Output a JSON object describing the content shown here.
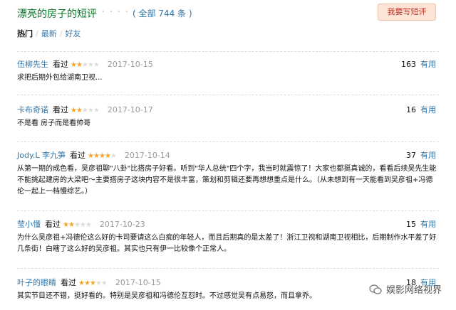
{
  "header": {
    "title": "漂亮的房子的短评",
    "dots": "· · · · · ·",
    "all_count": "( 全部 744 条 )",
    "write_button": "我要写短评"
  },
  "sort": {
    "hot": "热门",
    "latest": "最新",
    "friends": "好友",
    "separator": "/"
  },
  "reviews": [
    {
      "author": "伍柳先生",
      "saw": "看过",
      "rating_stars": 2,
      "date": "2017-10-15",
      "votes": "163",
      "votes_label": "有用",
      "text": "求把后期外包给湖南卫视..."
    },
    {
      "author": "卡布奇诺",
      "saw": "看过",
      "rating_stars": 2,
      "date": "2017-10-17",
      "votes": "16",
      "votes_label": "有用",
      "text": "不是看 房子而是看帅哥"
    },
    {
      "author": "Jody.L 李九笋",
      "saw": "看过",
      "rating_stars": 4,
      "date": "2017-10-14",
      "votes": "37",
      "votes_label": "有用",
      "text": "从第一期的成色看，吴彦祖聊\"八卦\"比搭房子好看。听到\"华人总统\"四个字，我当时就震惊了！大家也都挺真诚的，看看后续吴先生能不能挑起建房的大梁吧～主要搭房子这块内容不是很丰富，策划和剪辑还要再想想重点是什么。（从未想到有一天能看到吴彦祖+冯德伦一起上一档慢综艺。）"
    },
    {
      "author": "莹小懂",
      "saw": "看过",
      "rating_stars": 2,
      "date": "2017-10-23",
      "votes": "15",
      "votes_label": "有用",
      "text": "为什么吴彦祖+冯德伦这么好的卡司要请这么白痴的年轻人，而且后期真的是太差了！浙江卫视和湖南卫视相比，后期制作水平差了好几条街！白瞎了这么好的吴彦祖。其实也只有伊一比较像个正常人。"
    },
    {
      "author": "叶子的眼睛",
      "saw": "看过",
      "rating_stars": 3,
      "date": "2017-10-15",
      "votes": "18",
      "votes_label": "有用",
      "text": "其实节目还不错，挺好看的。特别是吴彦祖和冯德伦互怼时。不过感觉吴有点易怒，而且拿乔。"
    }
  ],
  "watermark": {
    "text": "娱影网络视界",
    "icon": "wechat-icon"
  },
  "colors": {
    "title_green": "#007722",
    "link_blue": "#3377aa",
    "star_orange": "#f5a623",
    "button_bg": "#fde4d6",
    "button_text": "#c0392b"
  }
}
